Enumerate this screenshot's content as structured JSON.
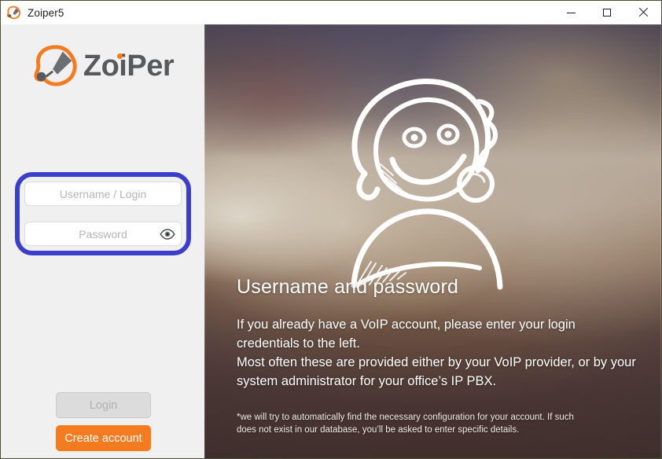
{
  "window": {
    "title": "Zoiper5",
    "app_icon": "zoiper-icon",
    "controls": {
      "minimize": "minimize-icon",
      "maximize": "maximize-icon",
      "close": "close-icon"
    }
  },
  "brand": {
    "logo_icon": "zoiper-logo-icon",
    "wordmark_prefix": "Zo",
    "wordmark_i": "i",
    "wordmark_suffix": "Per",
    "wordmark_full": "ZoiPer",
    "accent_color": "#f47b20",
    "text_color": "#58595b"
  },
  "login_form": {
    "highlight_color": "#3b3fc7",
    "username": {
      "value": "",
      "placeholder": "Username / Login"
    },
    "password": {
      "value": "",
      "placeholder": "Password",
      "reveal_icon": "eye-icon"
    },
    "login_button": {
      "label": "Login",
      "enabled": false
    },
    "create_account_button": {
      "label": "Create account",
      "color": "#f47b20"
    }
  },
  "info_panel": {
    "illustration": "smiley-face-headset-doodle",
    "headline": "Username and password",
    "body": " If you already have a VoIP account, please enter your login credentials to the left.\nMost often these are provided either by your VoIP provider, or by your system administrator for your office’s IP PBX.",
    "footnote": "*we will try to automatically find the necessary configuration for your account. If such does not exist in our database, you’ll be asked to enter specific details."
  }
}
